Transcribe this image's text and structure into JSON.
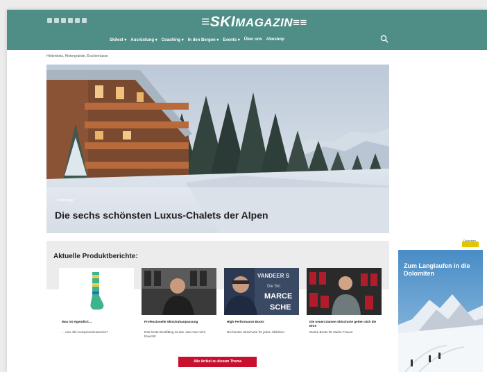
{
  "header": {
    "logo_prefix": "≡SKI",
    "logo_suffix": "MAGAZIN≡≡",
    "nav": [
      "Skitest ▾",
      "Ausrüstung ▾",
      "Coaching ▾",
      "In den Bergen ▾",
      "Events ▾",
      "Über uns",
      "Aboshop"
    ],
    "social_icons": [
      "facebook-icon",
      "instagram-icon",
      "youtube-icon",
      "tiktok-icon",
      "mail-icon",
      "rss-icon"
    ]
  },
  "breadcrumb": "Hintertests, Hintergründe, Erscheinüsse",
  "hero": {
    "kicker": "Unterwegs",
    "title": "Die sechs schönsten Luxus-Chalets der Alpen"
  },
  "products": {
    "title": "Aktuelle Produktberichte:",
    "cards": [
      {
        "title": "Was ist eigentlich ...",
        "desc": "... eine Ski-Kompressionssocke?"
      },
      {
        "title": "Professionelle Skischuhanpassung",
        "desc": "Das beste Bootfitting ist das, das man nicht braucht!"
      },
      {
        "title": "High Performance Boots",
        "desc": "Die besten Skischuhe für jeden Skifahrer"
      },
      {
        "title": "Die neuen Damen-Skischuhe gehen sich die Ehre",
        "desc": "Starke Boots für starke Frauen"
      }
    ],
    "card3_sign": [
      "VANDEER S",
      "Die Ski",
      "MARCE",
      "SCHE"
    ],
    "all_button": "Alle Artikel zu diesem Thema"
  },
  "ad": {
    "brand": "Dolomiten",
    "text": "Zum Langlaufen in die Dolomiten"
  },
  "colors": {
    "header": "#4f8e86",
    "button": "#c8102e",
    "sky_ad": "#4a90c8"
  }
}
